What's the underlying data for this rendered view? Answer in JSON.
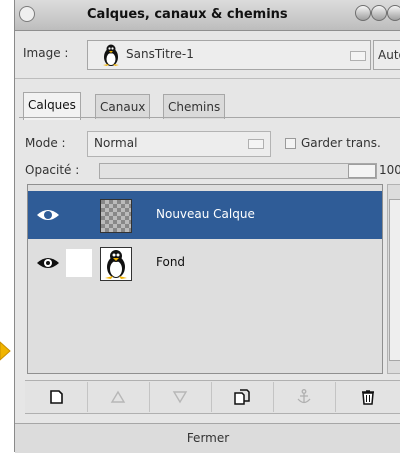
{
  "window": {
    "title": "Calques, canaux & chemins"
  },
  "image_selector": {
    "label": "Image :",
    "value": "SansTitre-1",
    "auto_button": "Auto"
  },
  "tabs": [
    {
      "label": "Calques",
      "active": true
    },
    {
      "label": "Canaux",
      "active": false
    },
    {
      "label": "Chemins",
      "active": false
    }
  ],
  "mode": {
    "label": "Mode :",
    "value": "Normal",
    "keep_trans_label": "Garder trans."
  },
  "opacity": {
    "label": "Opacité :",
    "value": "100.0",
    "level": 1.0
  },
  "layers": [
    {
      "name": "Nouveau Calque",
      "visible": true,
      "selected": true,
      "thumbnail": "checkerboard-thumbnail"
    },
    {
      "name": "Fond",
      "visible": true,
      "selected": false,
      "thumbnail": "penguin-thumbnail"
    }
  ],
  "toolbar_buttons": [
    {
      "icon": "new-layer-icon",
      "enabled": true
    },
    {
      "icon": "raise-layer-icon",
      "enabled": false
    },
    {
      "icon": "lower-layer-icon",
      "enabled": false
    },
    {
      "icon": "duplicate-layer-icon",
      "enabled": true
    },
    {
      "icon": "anchor-layer-icon",
      "enabled": false
    },
    {
      "icon": "delete-layer-icon",
      "enabled": true
    }
  ],
  "close_button": "Fermer",
  "colors": {
    "selection": "#2f5c97",
    "window_bg": "#e6e6e6",
    "outside_marker": "#f0b400"
  }
}
